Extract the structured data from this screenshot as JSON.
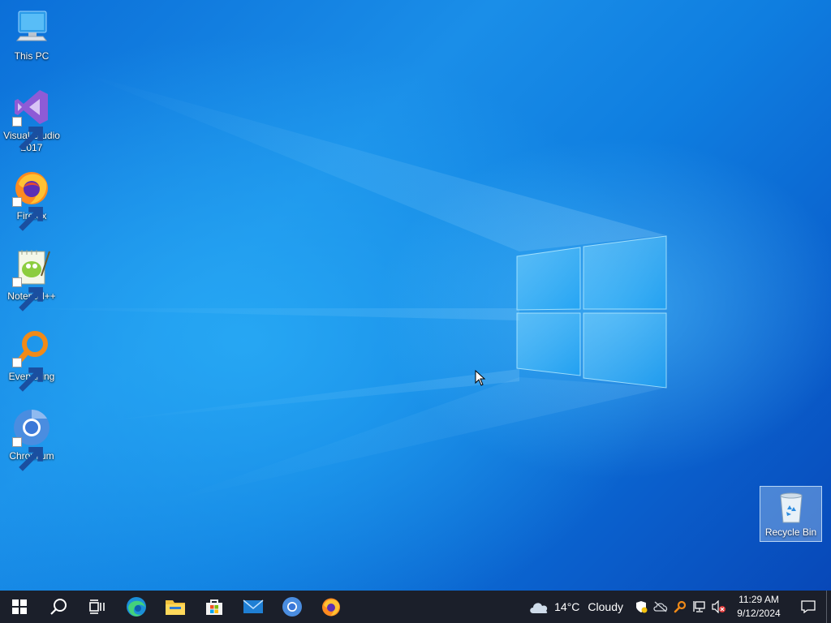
{
  "desktop": {
    "icons": [
      {
        "label": "This PC",
        "icon": "computer-icon",
        "shortcut": false
      },
      {
        "label": "Visual Studio 2017",
        "icon": "visual-studio-icon",
        "shortcut": true
      },
      {
        "label": "Firefox",
        "icon": "firefox-icon",
        "shortcut": true
      },
      {
        "label": "Notepad++",
        "icon": "notepad-plus-plus-icon",
        "shortcut": true
      },
      {
        "label": "Everything",
        "icon": "everything-search-icon",
        "shortcut": true
      },
      {
        "label": "Chromium",
        "icon": "chromium-icon",
        "shortcut": true
      }
    ],
    "recycle_bin": {
      "label": "Recycle Bin",
      "icon": "recycle-bin-icon",
      "selected": true
    }
  },
  "taskbar": {
    "start": {
      "icon": "windows-start-icon"
    },
    "search": {
      "icon": "search-icon"
    },
    "task_view": {
      "icon": "task-view-icon"
    },
    "pinned": [
      {
        "name": "Microsoft Edge",
        "icon": "edge-icon"
      },
      {
        "name": "File Explorer",
        "icon": "file-explorer-icon"
      },
      {
        "name": "Microsoft Store",
        "icon": "store-icon"
      },
      {
        "name": "Mail",
        "icon": "mail-icon"
      },
      {
        "name": "Chromium",
        "icon": "chromium-icon"
      },
      {
        "name": "Firefox",
        "icon": "firefox-icon"
      }
    ],
    "weather": {
      "temp": "14°C",
      "condition": "Cloudy",
      "icon": "cloud-icon"
    },
    "tray": [
      {
        "icon": "security-shield-icon"
      },
      {
        "icon": "onedrive-offline-icon"
      },
      {
        "icon": "everything-tray-icon"
      },
      {
        "icon": "network-icon"
      },
      {
        "icon": "volume-muted-icon"
      }
    ],
    "clock": {
      "time": "11:29 AM",
      "date": "9/12/2024"
    },
    "notifications": {
      "icon": "notification-icon"
    }
  },
  "colors": {
    "taskbar": "#1b1f2a",
    "desktop_blue": "#0b6fd8",
    "accent": "#1a8ee8"
  }
}
